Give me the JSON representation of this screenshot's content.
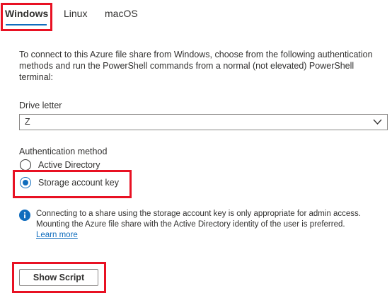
{
  "tabs": [
    {
      "label": "Windows",
      "selected": true
    },
    {
      "label": "Linux",
      "selected": false
    },
    {
      "label": "macOS",
      "selected": false
    }
  ],
  "description": "To connect to this Azure file share from Windows, choose from the following authentication methods and run the PowerShell commands from a normal (not elevated) PowerShell terminal:",
  "drive_letter": {
    "label": "Drive letter",
    "value": "Z",
    "icon": "chevron-down-icon"
  },
  "authentication": {
    "label": "Authentication method",
    "options": [
      {
        "label": "Active Directory",
        "checked": false
      },
      {
        "label": "Storage account key",
        "checked": true
      }
    ]
  },
  "info": {
    "icon": "info-icon",
    "text": "Connecting to a share using the storage account key is only appropriate for admin access. Mounting the Azure file share with the Active Directory identity of the user is preferred.",
    "link_label": "Learn more"
  },
  "show_script_button": {
    "label": "Show Script"
  },
  "colors": {
    "accent": "#0f6cbd",
    "highlight_box": "#e81123",
    "text": "#323130",
    "border": "#8a8886"
  }
}
